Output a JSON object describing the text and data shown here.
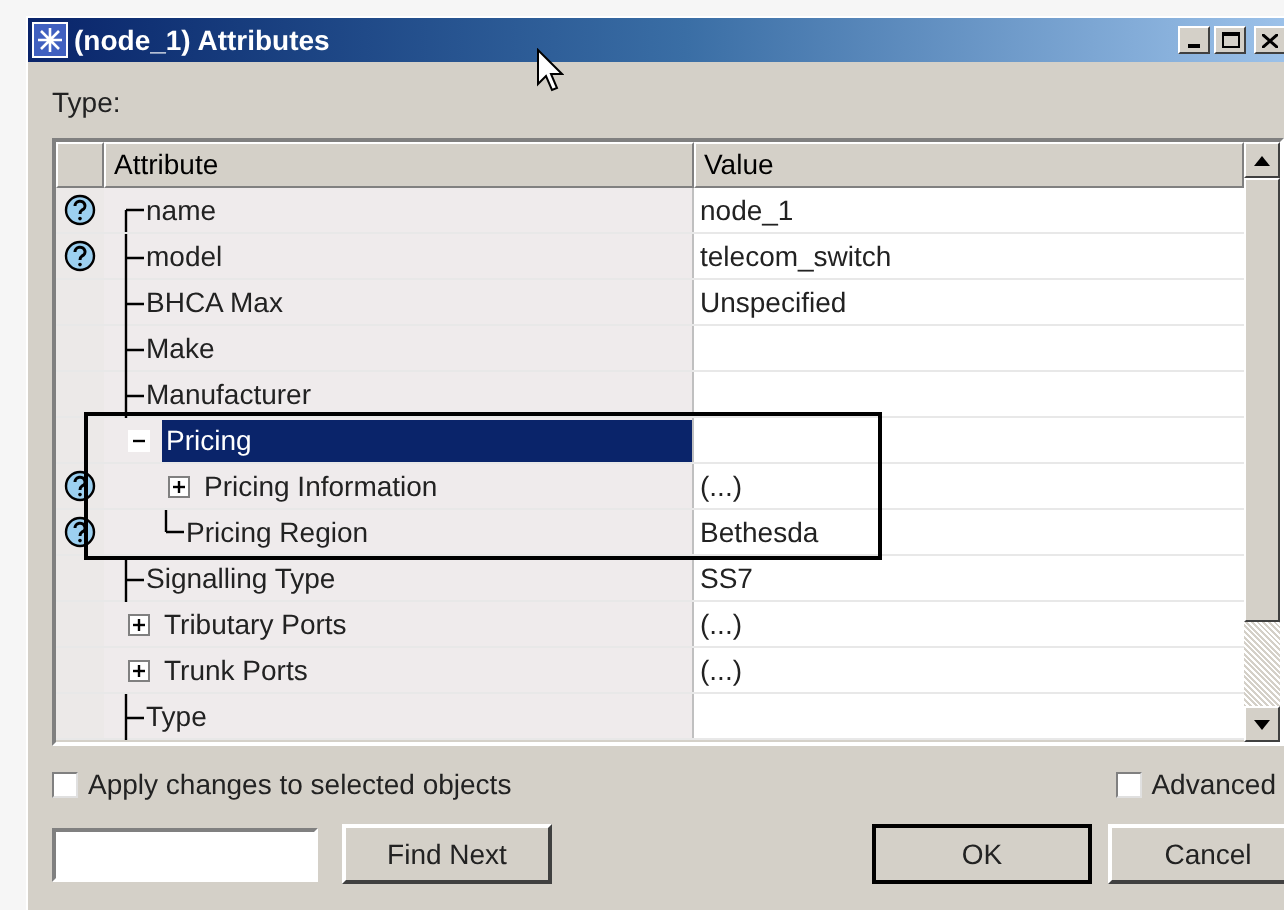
{
  "window": {
    "title": "(node_1) Attributes"
  },
  "type_label": "Type:",
  "table": {
    "columns": [
      "Attribute",
      "Value"
    ],
    "rows": [
      {
        "attribute": "name",
        "value": "node_1",
        "help": true,
        "selected": false
      },
      {
        "attribute": "model",
        "value": "telecom_switch",
        "help": true,
        "selected": false
      },
      {
        "attribute": "BHCA Max",
        "value": "Unspecified",
        "help": false,
        "selected": false
      },
      {
        "attribute": "Make",
        "help": false,
        "selected": false
      },
      {
        "attribute": "Manufacturer",
        "help": false,
        "selected": false
      },
      {
        "attribute": "Pricing",
        "help": false,
        "selected": true,
        "expanded": true,
        "children": [
          {
            "attribute": "Pricing Information",
            "value": "(...)",
            "help": true,
            "selected": false,
            "expanded": false
          },
          {
            "attribute": "Pricing Region",
            "value": "Bethesda",
            "help": true,
            "selected": false
          }
        ]
      },
      {
        "attribute": "Signalling Type",
        "value": "SS7",
        "help": false,
        "selected": false
      },
      {
        "attribute": "Tributary Ports",
        "value": "(...)",
        "help": false,
        "selected": false,
        "expanded": false
      },
      {
        "attribute": "Trunk Ports",
        "value": "(...)",
        "help": false,
        "selected": false,
        "expanded": false
      },
      {
        "attribute": "Type",
        "help": false,
        "selected": false
      }
    ]
  },
  "apply_checkbox": {
    "label": "Apply changes to selected objects",
    "checked": false
  },
  "advanced_checkbox": {
    "label": "Advanced",
    "checked": false
  },
  "buttons": [
    "Find Next",
    "OK",
    "Cancel"
  ]
}
